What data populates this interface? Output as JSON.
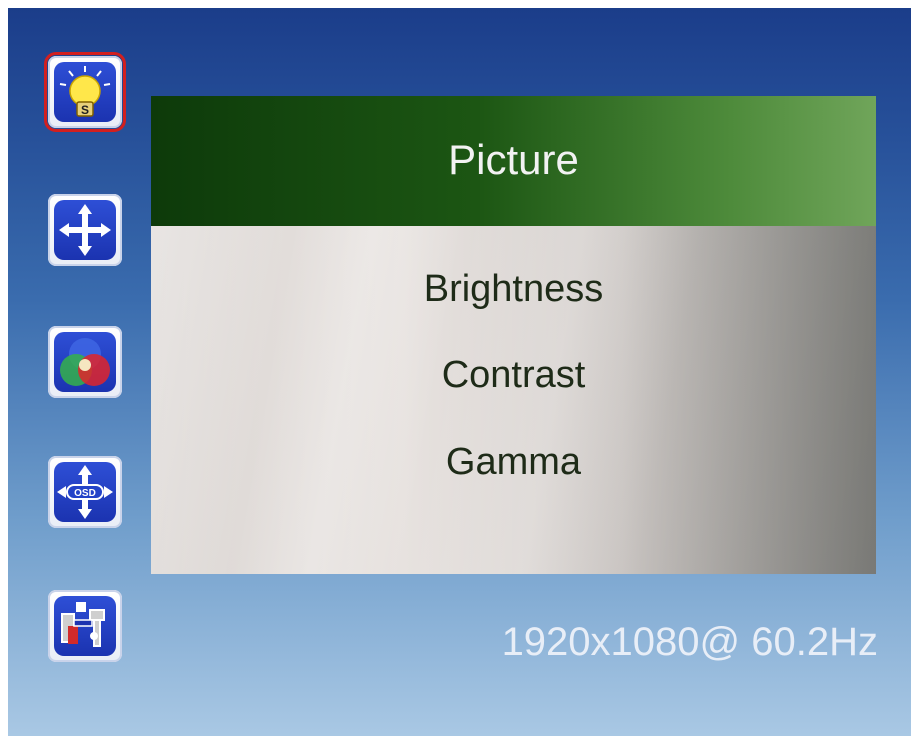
{
  "osd": {
    "icons": [
      {
        "name": "brightness-bulb-icon",
        "selected": true
      },
      {
        "name": "position-arrows-icon",
        "selected": false
      },
      {
        "name": "color-circles-icon",
        "selected": false
      },
      {
        "name": "osd-position-icon",
        "selected": false,
        "label": "OSD"
      },
      {
        "name": "tools-icon",
        "selected": false
      }
    ],
    "bulb_letter": "S",
    "panel": {
      "title": "Picture",
      "items": [
        {
          "label": "Brightness"
        },
        {
          "label": "Contrast"
        },
        {
          "label": "Gamma"
        }
      ]
    },
    "status": {
      "resolution": "1920x1080@ 60.2Hz"
    },
    "colors": {
      "selection_outline": "#d21f1f",
      "header_green": "#1c5613",
      "icon_blue": "#2443c8"
    }
  }
}
